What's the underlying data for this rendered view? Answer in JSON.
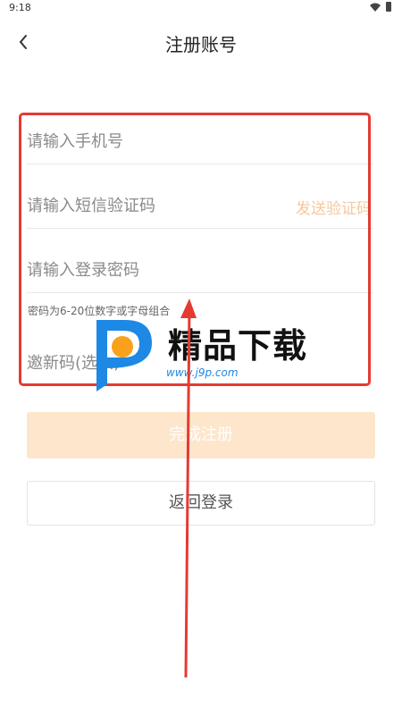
{
  "status_bar": {
    "time": "9:18"
  },
  "header": {
    "title": "注册账号"
  },
  "form": {
    "phone_placeholder": "请输入手机号",
    "sms_placeholder": "请输入短信验证码",
    "send_code_label": "发送验证码",
    "password_placeholder": "请输入登录密码",
    "password_hint": "密码为6-20位数字或字母组合",
    "invite_placeholder": "邀新码(选填)"
  },
  "buttons": {
    "register_label": "完成注册",
    "back_to_login_label": "返回登录"
  },
  "watermark": {
    "brand": "精品下载",
    "url": "www.j9p.com"
  },
  "colors": {
    "annotation_red": "#e53a32",
    "send_code_orange": "#f7c79c",
    "primary_btn_bg": "#fde6cc",
    "watermark_blue": "#1e88e5",
    "watermark_orange": "#f9a11b"
  }
}
